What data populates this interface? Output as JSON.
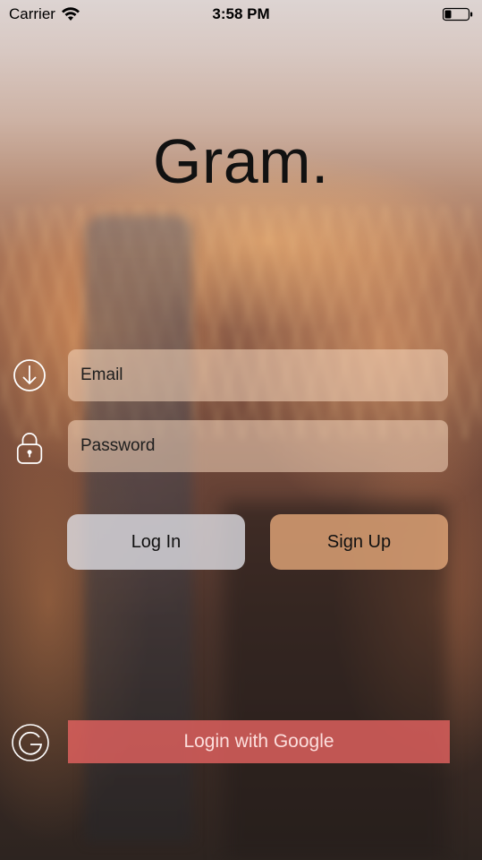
{
  "status_bar": {
    "carrier": "Carrier",
    "time": "3:58 PM"
  },
  "app": {
    "title": "Gram."
  },
  "form": {
    "email": {
      "placeholder": "Email",
      "value": ""
    },
    "password": {
      "placeholder": "Password",
      "value": ""
    }
  },
  "buttons": {
    "login_label": "Log In",
    "signup_label": "Sign Up",
    "google_label": "Login with Google"
  },
  "icons": {
    "email": "download-circle-icon",
    "password": "padlock-icon",
    "google": "google-logo-icon",
    "wifi": "wifi-icon",
    "battery": "battery-icon"
  },
  "colors": {
    "login_button": "#e1e1e8",
    "signup_button": "#e1a578",
    "google_button": "#e2625f",
    "field_background": "#f5d7be"
  }
}
